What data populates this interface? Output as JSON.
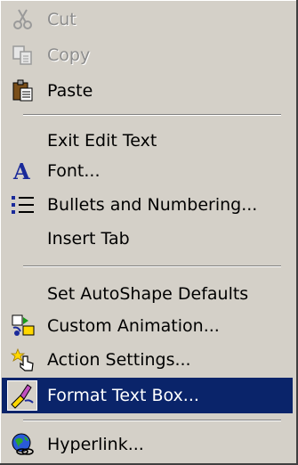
{
  "menu": {
    "items": [
      {
        "label": "Cut",
        "icon": "scissors-icon",
        "state": "disabled"
      },
      {
        "label": "Copy",
        "icon": "copy-icon",
        "state": "disabled"
      },
      {
        "label": "Paste",
        "icon": "paste-icon",
        "state": "normal"
      },
      {
        "label": "Exit Edit Text",
        "icon": "",
        "state": "normal"
      },
      {
        "label": "Font...",
        "icon": "font-icon",
        "state": "normal"
      },
      {
        "label": "Bullets and Numbering...",
        "icon": "bullets-icon",
        "state": "normal"
      },
      {
        "label": "Insert Tab",
        "icon": "",
        "state": "normal"
      },
      {
        "label": "Set AutoShape Defaults",
        "icon": "",
        "state": "normal"
      },
      {
        "label": "Custom Animation...",
        "icon": "animation-icon",
        "state": "normal"
      },
      {
        "label": "Action Settings...",
        "icon": "action-settings-icon",
        "state": "normal"
      },
      {
        "label": "Format Text Box...",
        "icon": "format-text-box-icon",
        "state": "selected"
      },
      {
        "label": "Hyperlink...",
        "icon": "hyperlink-globe-icon",
        "state": "normal"
      }
    ]
  },
  "colors": {
    "menu_bg": "#d4d0c8",
    "highlight": "#0a246a",
    "disabled_text": "#8c8c8c"
  }
}
